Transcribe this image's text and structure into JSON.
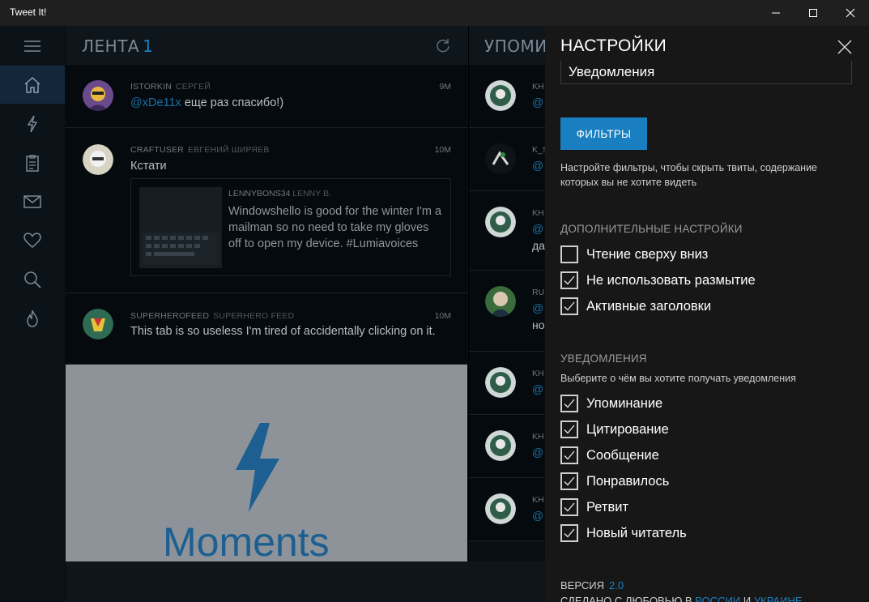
{
  "window": {
    "title": "Tweet It!"
  },
  "nav": {
    "items": [
      {
        "icon": "home-icon"
      },
      {
        "icon": "lightning-icon"
      },
      {
        "icon": "clipboard-icon"
      },
      {
        "icon": "mail-icon"
      },
      {
        "icon": "heart-icon"
      },
      {
        "icon": "search-icon"
      },
      {
        "icon": "fire-icon"
      }
    ]
  },
  "feed": {
    "title": "ЛЕНТА",
    "count": "1",
    "tweets": [
      {
        "handle": "ISTORKIN",
        "name": "СЕРГЕЙ",
        "time": "9M",
        "mention": "@xDe11x",
        "text": " еще раз спасибо!)"
      },
      {
        "handle": "CRAFTUSER",
        "name": "ЕВГЕНИЙ ШИРЯЕВ",
        "time": "10M",
        "text": "Кстати",
        "quote": {
          "handle": "LENNYBONS34",
          "name": "LENNY B.",
          "text": "Windowshello is good for the winter I'm a mailman so no need to take my gloves off to open my device. #Lumiavoices"
        }
      },
      {
        "handle": "SUPERHEROFEED",
        "name": "SUPERHERO FEED",
        "time": "10M",
        "text": "This tab is so useless I'm tired of accidentally clicking on it."
      }
    ],
    "moments_label": "Moments"
  },
  "mentions": {
    "title": "УПОМИ",
    "items": [
      {
        "h": "KH",
        "m": "@"
      },
      {
        "h": "K_S",
        "m": "@"
      },
      {
        "h": "KH",
        "m": "@",
        "t": "да"
      },
      {
        "h": "RU",
        "m": "@",
        "t": "но"
      },
      {
        "h": "KH",
        "m": "@"
      },
      {
        "h": "KH",
        "m": "@"
      },
      {
        "h": "KH",
        "m": "@"
      }
    ]
  },
  "settings": {
    "title": "НАСТРОЙКИ",
    "select_value": "Уведомления",
    "filters_button": "ФИЛЬТРЫ",
    "filters_desc": "Настройте фильтры, чтобы скрыть твиты, содержание которых вы не хотите видеть",
    "advanced_title": "ДОПОЛНИТЕЛЬНЫЕ НАСТРОЙКИ",
    "advanced": [
      {
        "label": "Чтение сверху вниз",
        "checked": false
      },
      {
        "label": "Не использовать размытие",
        "checked": true
      },
      {
        "label": "Активные заголовки",
        "checked": true
      }
    ],
    "notifications_title": "УВЕДОМЛЕНИЯ",
    "notifications_desc": "Выберите о чём вы хотите получать уведомления",
    "notifications": [
      {
        "label": "Упоминание",
        "checked": true
      },
      {
        "label": "Цитирование",
        "checked": true
      },
      {
        "label": "Сообщение",
        "checked": true
      },
      {
        "label": "Понравилось",
        "checked": true
      },
      {
        "label": "Ретвит",
        "checked": true
      },
      {
        "label": "Новый читатель",
        "checked": true
      }
    ],
    "version_label": "ВЕРСИЯ",
    "version_value": "2.0",
    "made_prefix": "СДЕЛАНО С ЛЮБОВЬЮ В",
    "made_link1": "РОССИИ",
    "made_and": "И",
    "made_link2": "УКРАИНЕ"
  },
  "colors": {
    "accent": "#1a7fc1",
    "nav_active": "#14273a",
    "settings_bg": "#171717"
  }
}
